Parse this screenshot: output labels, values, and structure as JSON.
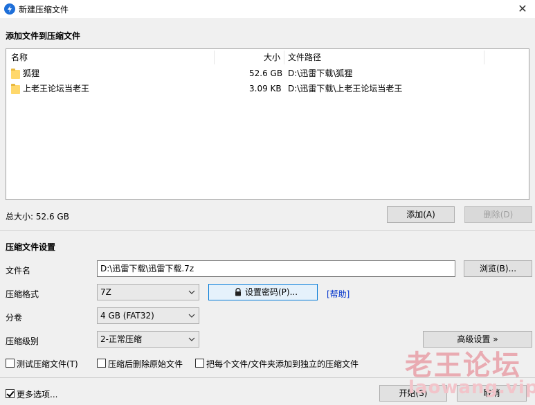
{
  "window": {
    "title": "新建压缩文件"
  },
  "add_section": {
    "heading": "添加文件到压缩文件"
  },
  "file_list": {
    "columns": {
      "name": "名称",
      "size": "大小",
      "path": "文件路径"
    },
    "rows": [
      {
        "name": "狐狸",
        "size": "52.6 GB",
        "path": "D:\\迅雷下载\\狐狸"
      },
      {
        "name": "上老王论坛当老王",
        "size": "3.09 KB",
        "path": "D:\\迅雷下载\\上老王论坛当老王"
      }
    ]
  },
  "total_size": "总大小: 52.6 GB",
  "buttons": {
    "add": "添加(A)",
    "delete": "删除(D)",
    "browse": "浏览(B)...",
    "set_password": "设置密码(P)...",
    "advanced": "高级设置 »",
    "start": "开始(S)",
    "cancel": "取消"
  },
  "settings": {
    "heading": "压缩文件设置",
    "filename_label": "文件名",
    "filename_value": "D:\\迅雷下载\\迅雷下载.7z",
    "format_label": "压缩格式",
    "format_value": "7Z",
    "help_link": "[帮助]",
    "split_label": "分卷",
    "split_value": "4 GB (FAT32)",
    "level_label": "压缩级别",
    "level_value": "2-正常压缩"
  },
  "options": {
    "test": {
      "label": "测试压缩文件(T)",
      "checked": false
    },
    "delete_source": {
      "label": "压缩后删除原始文件",
      "checked": false
    },
    "separate": {
      "label": "把每个文件/文件夹添加到独立的压缩文件",
      "checked": false
    },
    "more": {
      "label": "更多选项...",
      "checked": true
    }
  },
  "watermark": {
    "line1": "老王论坛",
    "line2": "laowang.vip"
  },
  "colors": {
    "accent": "#0078d7",
    "link": "#0033cc",
    "folder": "#ffd86b",
    "watermark": "#e8a0a8"
  }
}
